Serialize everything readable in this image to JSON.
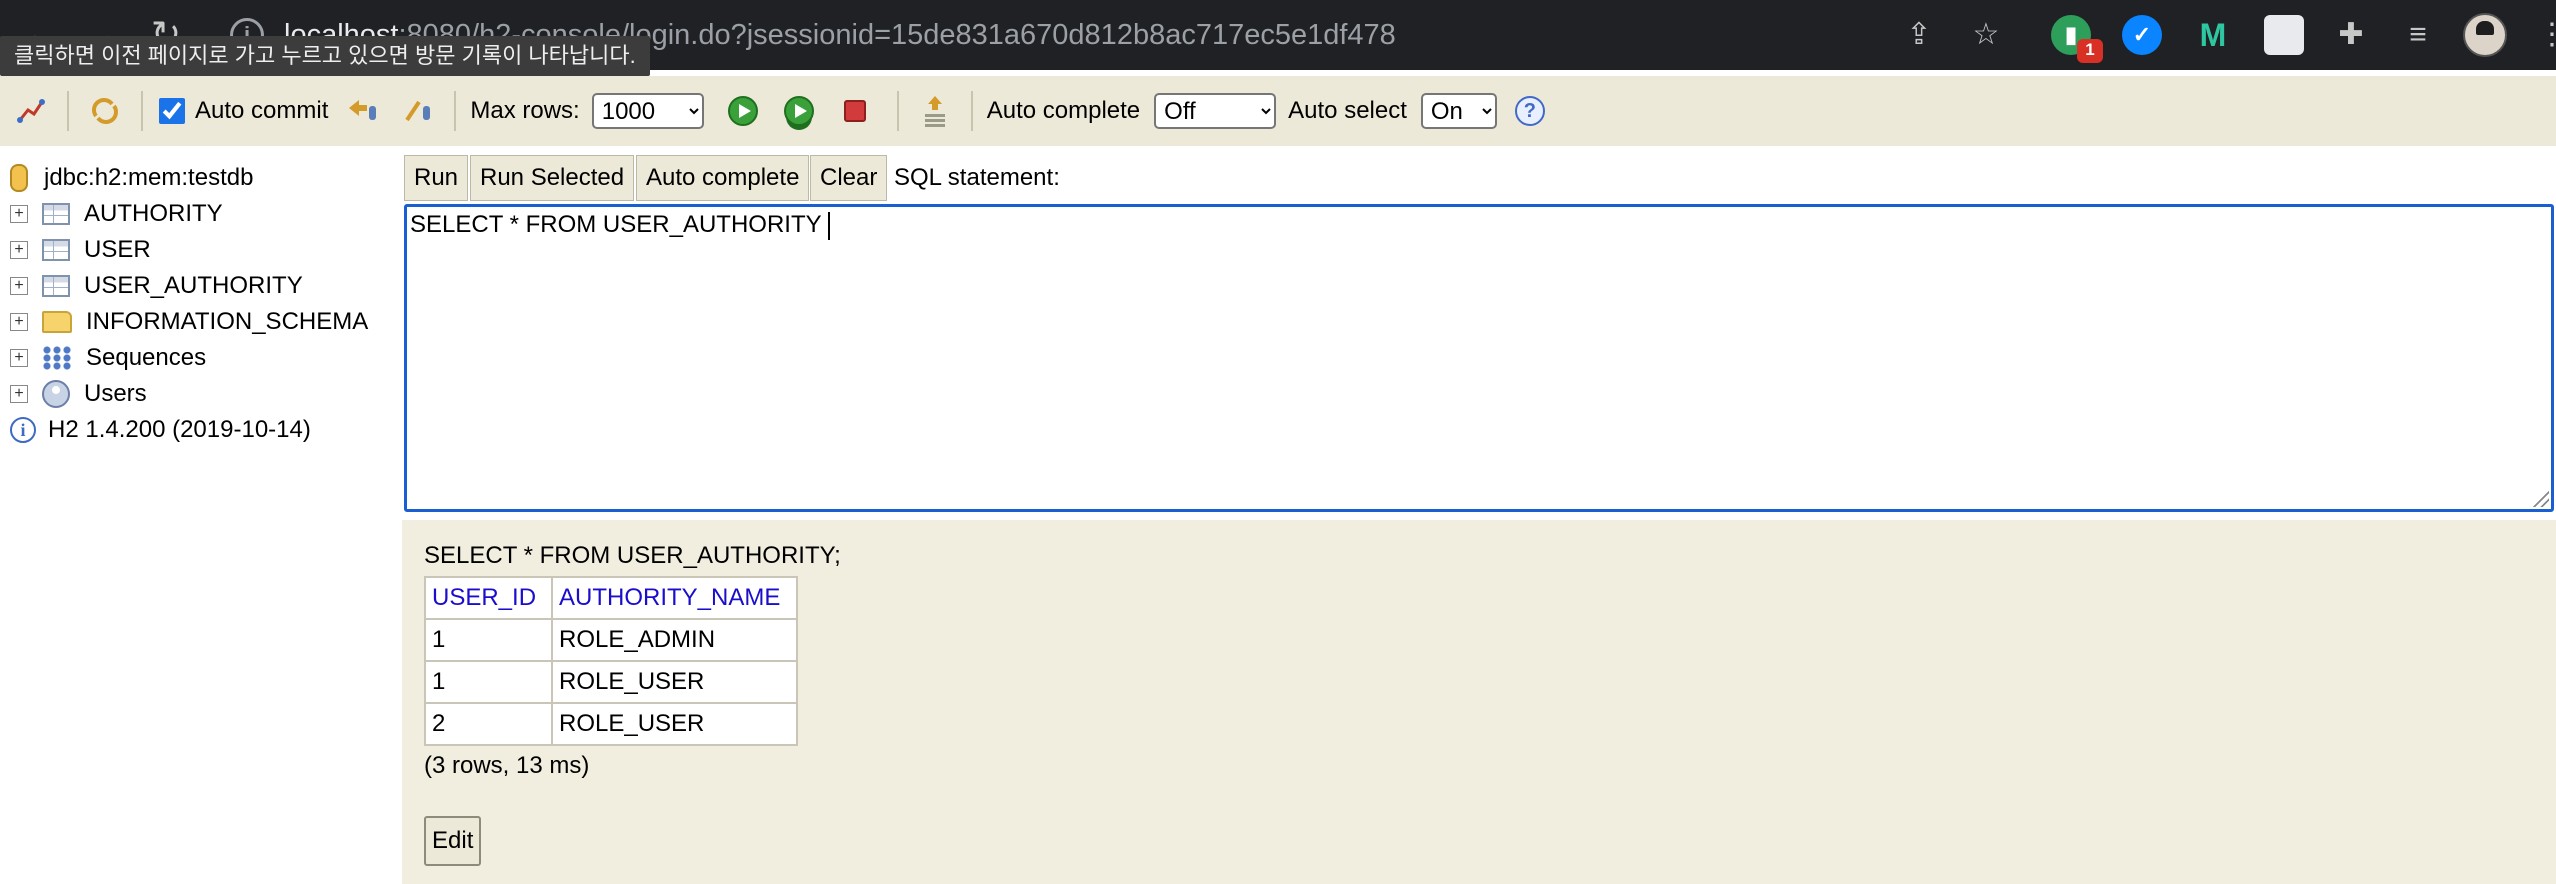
{
  "browser": {
    "url_host": "localhost",
    "url_rest": ":8080/h2-console/login.do?jsessionid=15de831a670d812b8ac717ec5e1df478",
    "tooltip": "클릭하면 이전 페이지로 가고 누르고 있으면 방문 기록이 나타납니다.",
    "ext_badge": "1",
    "ext_m_letter": "M"
  },
  "toolbar": {
    "auto_commit_label": "Auto commit",
    "auto_commit_checked": true,
    "max_rows_label": "Max rows:",
    "max_rows_value": "1000",
    "auto_complete_label": "Auto complete",
    "auto_complete_value": "Off",
    "auto_select_label": "Auto select",
    "auto_select_value": "On",
    "help_glyph": "?"
  },
  "tree": {
    "connection": "jdbc:h2:mem:testdb",
    "items": [
      {
        "label": "AUTHORITY",
        "icon": "table-icon"
      },
      {
        "label": "USER",
        "icon": "table-icon"
      },
      {
        "label": "USER_AUTHORITY",
        "icon": "table-icon"
      },
      {
        "label": "INFORMATION_SCHEMA",
        "icon": "folder-icon"
      },
      {
        "label": "Sequences",
        "icon": "sequences-icon"
      },
      {
        "label": "Users",
        "icon": "users-icon"
      }
    ],
    "version": "H2 1.4.200 (2019-10-14)"
  },
  "query": {
    "run": "Run",
    "run_selected": "Run Selected",
    "auto_complete": "Auto complete",
    "clear": "Clear",
    "sql_label": "SQL statement:",
    "sql_text": "SELECT * FROM USER_AUTHORITY"
  },
  "result": {
    "statement": "SELECT * FROM USER_AUTHORITY;",
    "columns": [
      "USER_ID",
      "AUTHORITY_NAME"
    ],
    "rows": [
      [
        "1",
        "ROLE_ADMIN"
      ],
      [
        "1",
        "ROLE_USER"
      ],
      [
        "2",
        "ROLE_USER"
      ]
    ],
    "summary": "(3 rows, 13 ms)",
    "edit": "Edit"
  }
}
